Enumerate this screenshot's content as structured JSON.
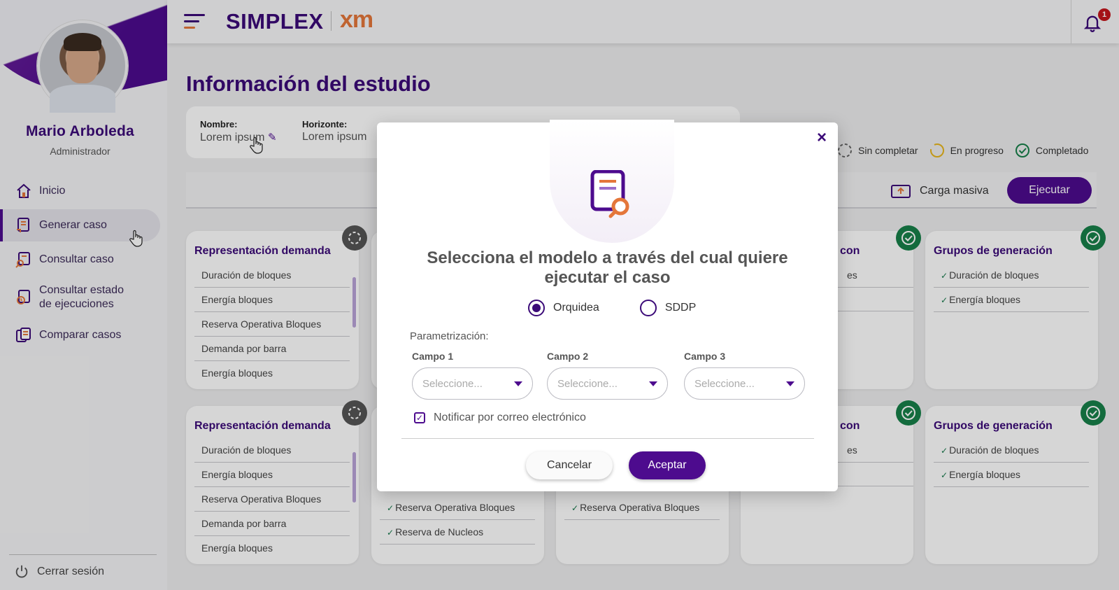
{
  "sidebar": {
    "user_name": "Mario Arboleda",
    "user_role": "Administrador",
    "items": [
      {
        "label": "Inicio",
        "icon": "home-icon"
      },
      {
        "label": "Generar caso",
        "icon": "generate-case-icon",
        "active": true
      },
      {
        "label": "Consultar caso",
        "icon": "search-case-icon"
      },
      {
        "label": "Consultar estado de ejecuciones",
        "icon": "execution-status-icon"
      },
      {
        "label": "Comparar casos",
        "icon": "compare-cases-icon"
      }
    ],
    "logout_label": "Cerrar sesión"
  },
  "topbar": {
    "brand": "SIMPLEX",
    "brand_xm": "xm",
    "notification_count": "1"
  },
  "main": {
    "title": "Información del estudio",
    "info": {
      "name_label": "Nombre:",
      "name_value": "Lorem ipsum",
      "horizon_label": "Horizonte:",
      "horizon_value": "Lorem ipsum"
    },
    "legend": {
      "incomplete": "Sin completar",
      "in_progress": "En progreso",
      "completed": "Completado"
    },
    "carga_masiva": "Carga masiva",
    "ejecutar": "Ejecutar",
    "cards": [
      {
        "title": "Representación demanda",
        "items": [
          "Duración de bloques",
          "Energía bloques",
          "Reserva Operativa Bloques",
          "Demanda por barra",
          "Energía bloques"
        ],
        "status": "pending"
      },
      {
        "title": "con",
        "items": [
          "es",
          ""
        ],
        "status": "done"
      },
      {
        "title": "Grupos de generación",
        "items": [
          "Duración de bloques",
          "Energía bloques"
        ],
        "status": "done"
      },
      {
        "title": "Representación demanda",
        "items": [
          "Duración de bloques",
          "Energía bloques",
          "Reserva Operativa Bloques",
          "Demanda por barra",
          "Energía bloques"
        ],
        "status": "pending"
      },
      {
        "title": "",
        "items": [
          "Reserva Operativa Bloques",
          "Reserva de Nucleos"
        ],
        "status": "none"
      },
      {
        "title": "",
        "items": [
          "Reserva Operativa Bloques"
        ],
        "status": "none"
      },
      {
        "title": "con",
        "items": [
          "es",
          ""
        ],
        "status": "done"
      },
      {
        "title": "Grupos de generación",
        "items": [
          "Duración de bloques",
          "Energía bloques"
        ],
        "status": "done"
      }
    ]
  },
  "modal": {
    "heading": "Selecciona el modelo a través del cual quiere ejecutar el caso",
    "options": [
      {
        "label": "Orquidea",
        "checked": true
      },
      {
        "label": "SDDP",
        "checked": false
      }
    ],
    "param_label": "Parametrización:",
    "fields": [
      {
        "label": "Campo 1",
        "placeholder": "Seleccione..."
      },
      {
        "label": "Campo 2",
        "placeholder": "Seleccione..."
      },
      {
        "label": "Campo 3",
        "placeholder": "Seleccione..."
      }
    ],
    "notify_label": "Notificar por correo  electrónico",
    "notify_checked": true,
    "cancel": "Cancelar",
    "accept": "Aceptar",
    "close": "×"
  },
  "colors": {
    "brand_purple": "#3b0a78",
    "accent_orange": "#e4763a",
    "success_green": "#178049"
  }
}
